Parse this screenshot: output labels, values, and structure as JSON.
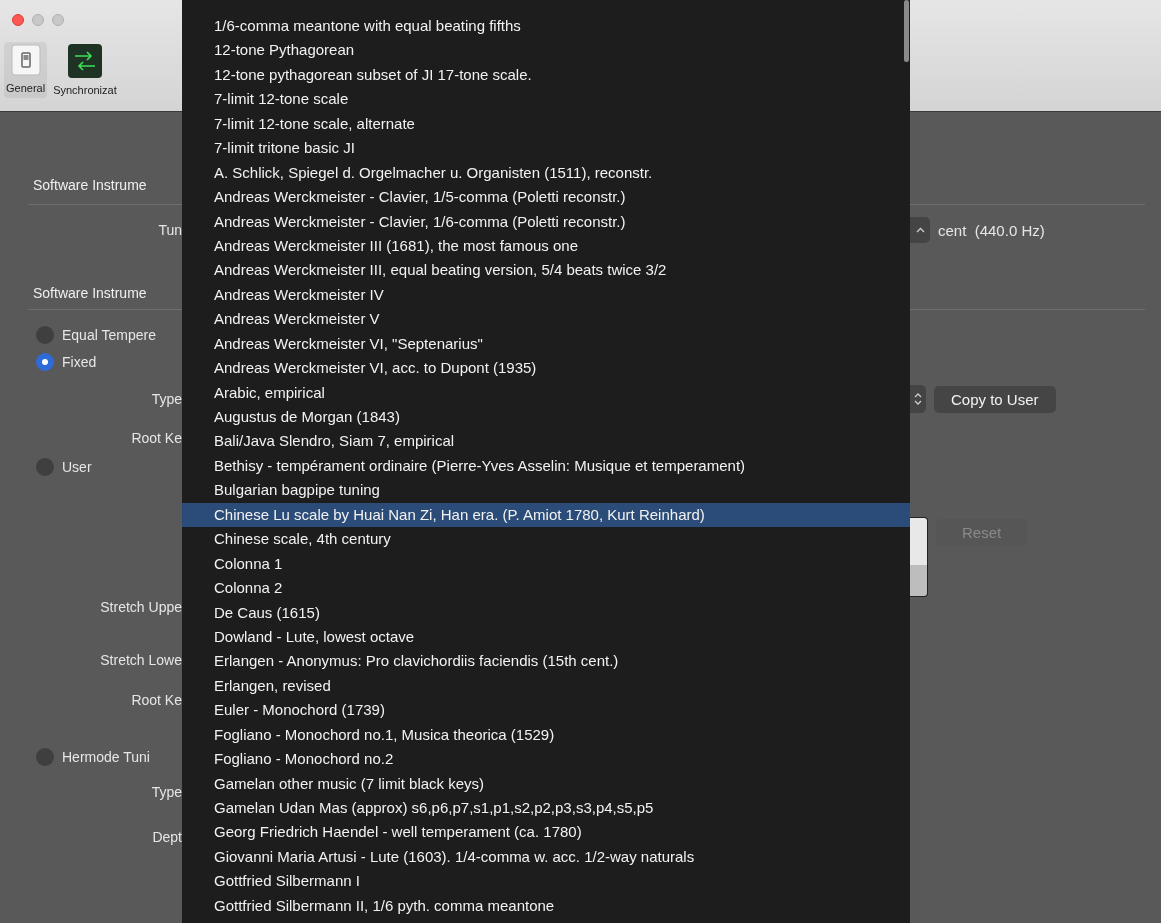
{
  "window": {
    "controls": [
      {
        "kind": "close"
      },
      {
        "kind": "minimize"
      },
      {
        "kind": "zoom"
      }
    ]
  },
  "toolbar": [
    {
      "label": "General",
      "kind": "general",
      "selected": true
    },
    {
      "label": "Synchronizat",
      "kind": "sync",
      "selected": false
    }
  ],
  "settings": [
    {
      "kind": "section",
      "label": "Software Instrume"
    },
    {
      "kind": "field",
      "label": "Tun",
      "control": {
        "kind": "stepper"
      },
      "suffix": "cent  (440.0 Hz)"
    },
    {
      "kind": "section",
      "label": "Software Instrume"
    },
    {
      "kind": "radio",
      "label": "Equal Tempere",
      "selected": false
    },
    {
      "kind": "radio",
      "label": "Fixed",
      "selected": true
    },
    {
      "kind": "field",
      "label": "Type",
      "control": {
        "kind": "popup"
      },
      "button": "Copy to User"
    },
    {
      "kind": "field",
      "label": "Root Ke"
    },
    {
      "kind": "radio",
      "label": "User",
      "selected": false
    },
    {
      "kind": "table",
      "button": "Reset",
      "disabled": true
    },
    {
      "kind": "field",
      "label": "Stretch Uppe"
    },
    {
      "kind": "field",
      "label": "Stretch Lowe"
    },
    {
      "kind": "field",
      "label": "Root Ke"
    },
    {
      "kind": "radio",
      "label": "Hermode Tuni",
      "selected": false
    },
    {
      "kind": "field",
      "label": "Type"
    },
    {
      "kind": "field",
      "label": "Dept"
    }
  ],
  "menu": {
    "items": [
      {
        "label": "1/6-comma meantone with equal beating fifths",
        "selected": false
      },
      {
        "label": "12-tone Pythagorean",
        "selected": false
      },
      {
        "label": "12-tone pythagorean subset of JI 17-tone scale.",
        "selected": false
      },
      {
        "label": "7-limit 12-tone scale",
        "selected": false
      },
      {
        "label": "7-limit 12-tone scale, alternate",
        "selected": false
      },
      {
        "label": "7-limit tritone basic JI",
        "selected": false
      },
      {
        "label": "A. Schlick, Spiegel d. Orgelmacher u. Organisten (1511), reconstr.",
        "selected": false
      },
      {
        "label": "Andreas Werckmeister - Clavier, 1/5-comma (Poletti reconstr.)",
        "selected": false
      },
      {
        "label": "Andreas Werckmeister - Clavier, 1/6-comma (Poletti reconstr.)",
        "selected": false
      },
      {
        "label": "Andreas Werckmeister III (1681), the most famous one",
        "selected": false
      },
      {
        "label": "Andreas Werckmeister III, equal beating version, 5/4 beats twice 3/2",
        "selected": false
      },
      {
        "label": "Andreas Werckmeister IV",
        "selected": false
      },
      {
        "label": "Andreas Werckmeister V",
        "selected": false
      },
      {
        "label": "Andreas Werckmeister VI, \"Septenarius\"",
        "selected": false
      },
      {
        "label": "Andreas Werckmeister VI, acc. to Dupont (1935)",
        "selected": false
      },
      {
        "label": "Arabic, empirical",
        "selected": false
      },
      {
        "label": "Augustus de Morgan (1843)",
        "selected": false
      },
      {
        "label": "Bali/Java Slendro, Siam 7, empirical",
        "selected": false
      },
      {
        "label": "Bethisy - tempérament ordinaire (Pierre-Yves Asselin: Musique et temperament)",
        "selected": false
      },
      {
        "label": "Bulgarian bagpipe tuning",
        "selected": false
      },
      {
        "label": "Chinese Lu scale by Huai Nan Zi, Han era. (P. Amiot 1780, Kurt Reinhard)",
        "selected": true
      },
      {
        "label": "Chinese scale, 4th century",
        "selected": false
      },
      {
        "label": "Colonna 1",
        "selected": false
      },
      {
        "label": "Colonna 2",
        "selected": false
      },
      {
        "label": "De Caus (1615)",
        "selected": false
      },
      {
        "label": "Dowland - Lute, lowest octave",
        "selected": false
      },
      {
        "label": "Erlangen - Anonymus: Pro clavichordiis faciendis (15th cent.)",
        "selected": false
      },
      {
        "label": "Erlangen, revised",
        "selected": false
      },
      {
        "label": "Euler - Monochord (1739)",
        "selected": false
      },
      {
        "label": "Fogliano - Monochord no.1, Musica theorica (1529)",
        "selected": false
      },
      {
        "label": "Fogliano - Monochord no.2",
        "selected": false
      },
      {
        "label": "Gamelan other music (7 limit black keys)",
        "selected": false
      },
      {
        "label": "Gamelan Udan Mas (approx) s6,p6,p7,s1,p1,s2,p2,p3,s3,p4,s5,p5",
        "selected": false
      },
      {
        "label": "Georg Friedrich Haendel - well temperament (ca. 1780)",
        "selected": false
      },
      {
        "label": "Giovanni Maria Artusi - Lute (1603). 1/4-comma w. acc. 1/2-way naturals",
        "selected": false
      },
      {
        "label": "Gottfried Silbermann I",
        "selected": false
      },
      {
        "label": "Gottfried Silbermann II, 1/6 pyth. comma meantone",
        "selected": false
      }
    ]
  }
}
